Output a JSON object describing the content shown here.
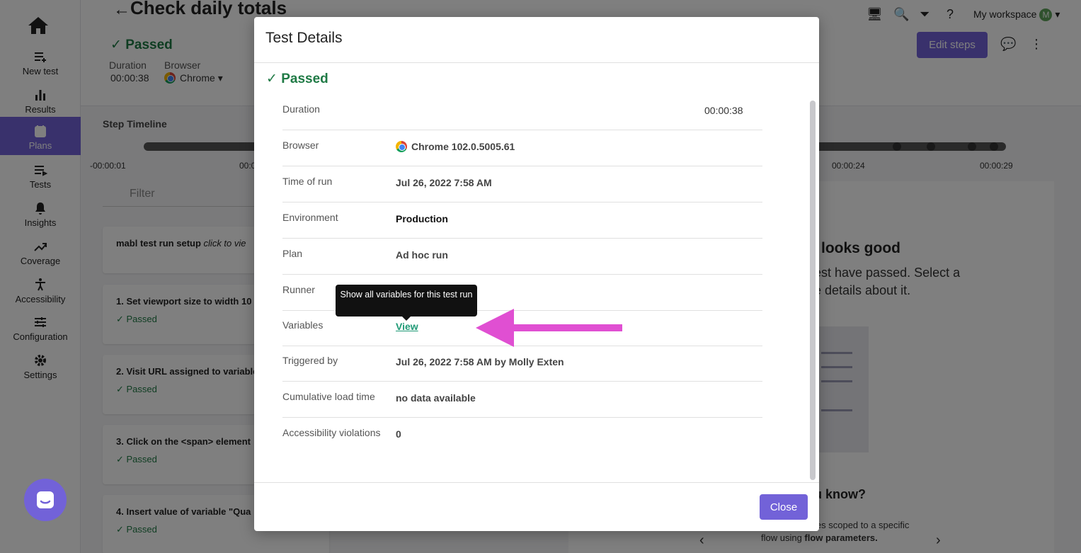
{
  "sidebar": {
    "items": [
      {
        "label": "New test",
        "icon": "new-test-icon"
      },
      {
        "label": "Results",
        "icon": "results-icon"
      },
      {
        "label": "Plans",
        "icon": "plans-icon",
        "active": true
      },
      {
        "label": "Tests",
        "icon": "tests-icon"
      },
      {
        "label": "Insights",
        "icon": "bell-icon"
      },
      {
        "label": "Coverage",
        "icon": "trend-icon"
      },
      {
        "label": "Accessibility",
        "icon": "accessibility-icon"
      },
      {
        "label": "Configuration",
        "icon": "sliders-icon"
      },
      {
        "label": "Settings",
        "icon": "gear-icon"
      }
    ]
  },
  "header": {
    "title": "Check daily totals",
    "status": "Passed",
    "duration_label": "Duration",
    "duration_value": "00:00:38",
    "browser_label": "Browser",
    "browser_value": "Chrome",
    "workspace": "My workspace",
    "workspace_avatar": "M",
    "edit_steps": "Edit steps"
  },
  "timeline": {
    "label": "Step Timeline",
    "ticks": [
      "-00:00:01",
      "00:0",
      "00:00:24",
      "00:00:29"
    ]
  },
  "filter": {
    "placeholder": "Filter"
  },
  "steps": [
    {
      "text": "mabl test run setup",
      "italic": "click to vie"
    },
    {
      "text": "1. Set viewport size to width 10",
      "status": "Passed"
    },
    {
      "text": "2. Visit URL assigned to variable",
      "status": "Passed"
    },
    {
      "text": "3. Click on the <span> element",
      "status": "Passed"
    },
    {
      "text": "4. Insert value of variable \"Qua",
      "status": "Passed"
    }
  ],
  "right_panel": {
    "title": "looks good",
    "text_line1": "est have passed. Select a",
    "text_line2": "e details about it.",
    "know_title": "u know?",
    "know_line1": "les scoped to a specific",
    "know_line2": "flow using ",
    "know_bold": "flow parameters."
  },
  "modal": {
    "title": "Test Details",
    "status": "Passed",
    "rows": [
      {
        "label": "Duration",
        "value": "00:00:38"
      },
      {
        "label": "Browser",
        "value": "Chrome 102.0.5005.61"
      },
      {
        "label": "Time of run",
        "value": "Jul 26, 2022 7:58 AM"
      },
      {
        "label": "Environment",
        "value": "Production"
      },
      {
        "label": "Plan",
        "value": "Ad hoc run"
      },
      {
        "label": "Runner",
        "value": ""
      },
      {
        "label": "Variables",
        "value": "View"
      },
      {
        "label": "Triggered by",
        "value": "Jul 26, 2022 7:58 AM by Molly Exten"
      },
      {
        "label": "Cumulative load time",
        "value": "no data available"
      },
      {
        "label": "Accessibility violations",
        "value": "0"
      }
    ],
    "close": "Close"
  },
  "tooltip": {
    "text": "Show all variables for this test run"
  },
  "colors": {
    "accent": "#7262d8",
    "passed": "#1f7a45",
    "link": "#1f9a76",
    "annotation_arrow": "#e04fd2"
  }
}
